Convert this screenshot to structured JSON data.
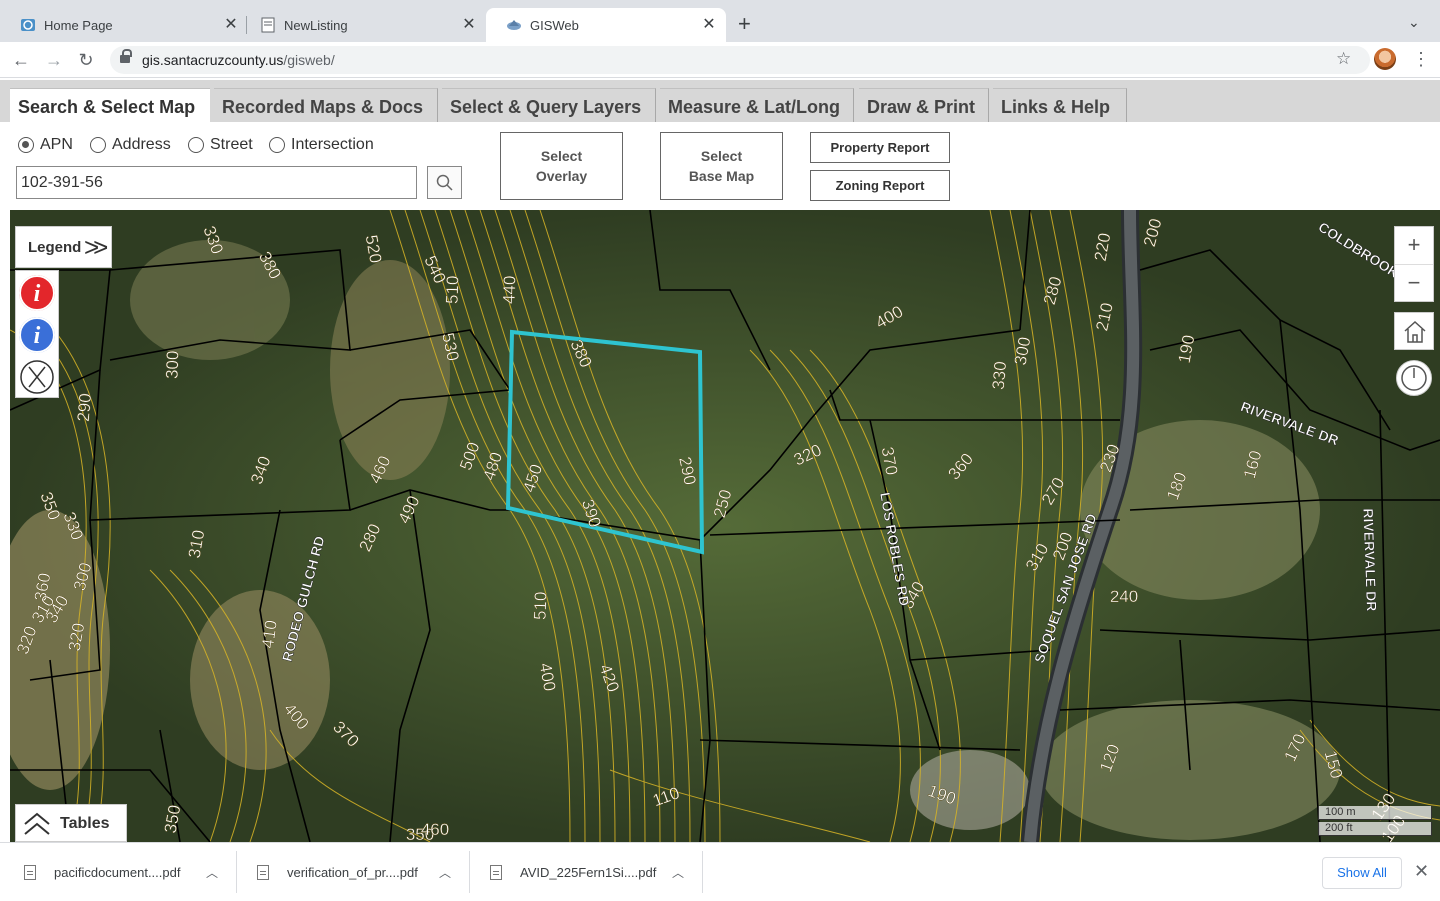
{
  "browser": {
    "tabs": [
      {
        "title": "Home Page",
        "icon": "globe-icon"
      },
      {
        "title": "NewListing",
        "icon": "document-icon"
      },
      {
        "title": "GISWeb",
        "icon": "gis-icon"
      }
    ],
    "url_host": "gis.santacruzcounty.us",
    "url_path": "/gisweb/"
  },
  "app": {
    "tabs": [
      {
        "label": "Search & Select Map"
      },
      {
        "label": "Recorded Maps & Docs"
      },
      {
        "label": "Select & Query Layers"
      },
      {
        "label": "Measure & Lat/Long"
      },
      {
        "label": "Draw & Print"
      },
      {
        "label": "Links & Help"
      }
    ],
    "search": {
      "options": [
        {
          "label": "APN",
          "selected": true
        },
        {
          "label": "Address",
          "selected": false
        },
        {
          "label": "Street",
          "selected": false
        },
        {
          "label": "Intersection",
          "selected": false
        }
      ],
      "value": "102-391-56"
    },
    "buttons": {
      "overlay": "Select\nOverlay",
      "basemap": "Select\nBase Map",
      "property_report": "Property Report",
      "zoning_report": "Zoning Report"
    },
    "map": {
      "legend_label": "Legend",
      "tables_label": "Tables",
      "scale_m": "100 m",
      "scale_ft": "200 ft",
      "zoom_in": "+",
      "zoom_out": "−",
      "contour_color": "#d9b526",
      "parcel_highlight_color": "#2ec4d0",
      "street_labels": [
        "LOS ROBLES RD",
        "SOQUEL SAN JOSE RD",
        "RODEO GULCH RD",
        "RIVERVALE DR",
        "RIVERVALE DR",
        "COLDBROOK"
      ],
      "contour_labels": [
        "330",
        "380",
        "520",
        "540",
        "510",
        "440",
        "530",
        "380",
        "400",
        "280",
        "300",
        "330",
        "220",
        "200",
        "210",
        "190",
        "300",
        "290",
        "340",
        "460",
        "500",
        "480",
        "450",
        "390",
        "290",
        "250",
        "320",
        "370",
        "360",
        "270",
        "230",
        "180",
        "160",
        "350",
        "330",
        "310",
        "320",
        "360",
        "300",
        "340",
        "310",
        "320",
        "280",
        "490",
        "510",
        "400",
        "370",
        "410",
        "400",
        "420",
        "340",
        "310",
        "200",
        "240",
        "120",
        "170",
        "150",
        "130",
        "100",
        "110",
        "350",
        "190",
        "350",
        "460"
      ]
    }
  },
  "downloads": {
    "items": [
      {
        "name": "pacificdocument....pdf"
      },
      {
        "name": "verification_of_pr....pdf"
      },
      {
        "name": "AVID_225Fern1Si....pdf"
      }
    ],
    "show_all": "Show All"
  }
}
